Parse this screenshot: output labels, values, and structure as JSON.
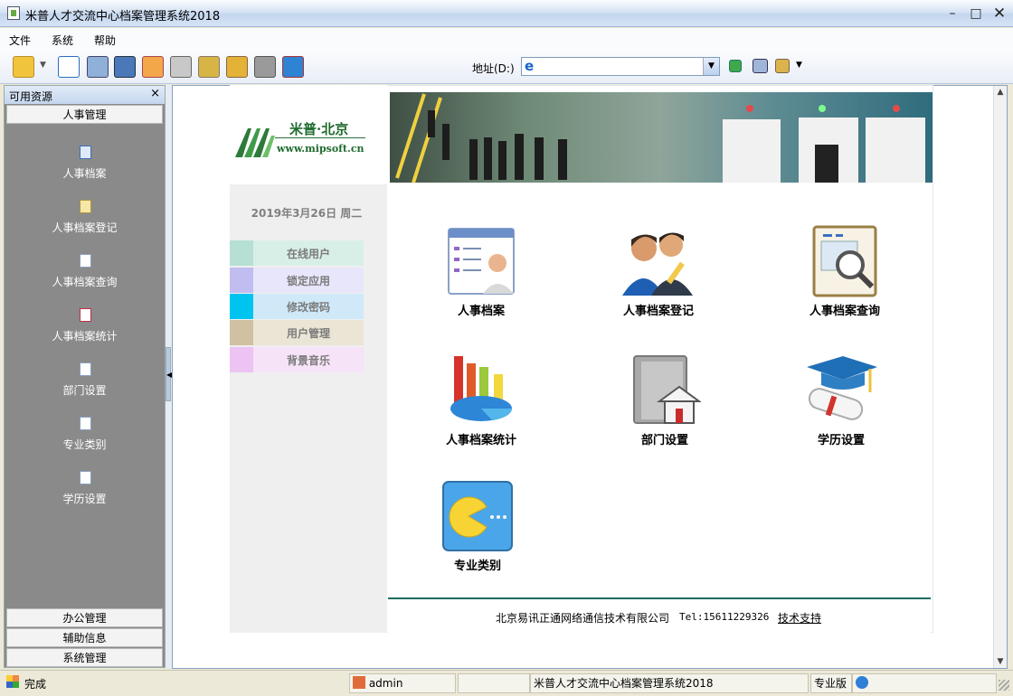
{
  "window": {
    "title": "米普人才交流中心档案管理系统2018",
    "controls": [
      "minimize",
      "maximize",
      "close"
    ]
  },
  "menu": {
    "items": [
      "文件",
      "系统",
      "帮助"
    ]
  },
  "toolbar": {
    "icons": [
      "open-folder-icon",
      "list-icon",
      "card-icon",
      "calculator-icon",
      "home-icon",
      "printer-icon",
      "key-icon",
      "lock-icon",
      "user-lock-icon",
      "exit-icon"
    ],
    "address_label": "地址(D:)",
    "address_value": ""
  },
  "left_panel": {
    "header": "可用资源",
    "close_glyph": "×",
    "active_group": "人事管理",
    "items": [
      {
        "label": "人事档案",
        "icon": "grid-icon"
      },
      {
        "label": "人事档案登记",
        "icon": "edit-doc-icon"
      },
      {
        "label": "人事档案查询",
        "icon": "search-doc-icon"
      },
      {
        "label": "人事档案统计",
        "icon": "stats-doc-icon"
      },
      {
        "label": "部门设置",
        "icon": "page-icon"
      },
      {
        "label": "专业类别",
        "icon": "page-icon"
      },
      {
        "label": "学历设置",
        "icon": "page-icon"
      }
    ],
    "bottom_groups": [
      "办公管理",
      "辅助信息",
      "系统管理"
    ]
  },
  "logo": {
    "name": "米普·北京",
    "url_text": "www.mipsoft.cn"
  },
  "side_nav": {
    "date": "2019年3月26日  周二",
    "items": [
      {
        "label": "在线用户",
        "swatch": "#b6e0d4",
        "bg": "#d8efe7"
      },
      {
        "label": "锁定应用",
        "swatch": "#c1bdf1",
        "bg": "#e8e6fa"
      },
      {
        "label": "修改密码",
        "swatch": "#00c4f0",
        "bg": "#cfe9f9"
      },
      {
        "label": "用户管理",
        "swatch": "#cfc1a2",
        "bg": "#ebe5d5"
      },
      {
        "label": "背景音乐",
        "swatch": "#ecc3f3",
        "bg": "#f6e3f8"
      }
    ]
  },
  "tiles": [
    {
      "label": "人事档案",
      "icon": "personnel-file-icon"
    },
    {
      "label": "人事档案登记",
      "icon": "users-register-icon"
    },
    {
      "label": "人事档案查询",
      "icon": "magnifier-doc-icon"
    },
    {
      "label": "人事档案统计",
      "icon": "chart-stats-icon"
    },
    {
      "label": "部门设置",
      "icon": "department-house-icon"
    },
    {
      "label": "学历设置",
      "icon": "graduation-cap-icon"
    },
    {
      "label": "专业类别",
      "icon": "pacman-category-icon"
    }
  ],
  "footer": {
    "company": "北京易讯正通网络通信技术有限公司",
    "tel": "Tel:15611229326",
    "support_link": "技术支持"
  },
  "statusbar": {
    "status": "完成",
    "user": "admin",
    "app_title": "米普人才交流中心档案管理系统2018",
    "edition": "专业版"
  }
}
